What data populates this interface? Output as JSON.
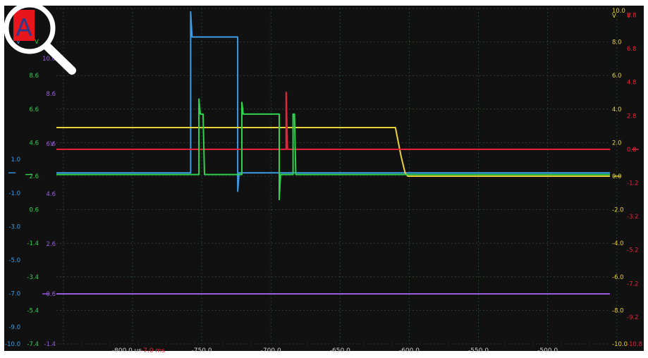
{
  "badge": {
    "letter": "A",
    "bg": "#e8161c",
    "letter_color": "#2d3a8c"
  },
  "colors": {
    "background": "#111111",
    "grid": "#2f4a3a",
    "blue": "#3d9be6",
    "yellow": "#e8d23a",
    "red": "#e8233a",
    "green": "#2fd24c",
    "purple": "#9a5ee0",
    "time_red": "#e8233a",
    "time_white": "#d0d0d0"
  },
  "chart_data": {
    "type": "line",
    "x_axis": {
      "unit_label": "us",
      "range": [
        -855,
        -455
      ],
      "ticks": [
        {
          "v": -800,
          "label": "-800.0"
        },
        {
          "v": -750,
          "label": "-750.0"
        },
        {
          "v": -700,
          "label": "-700.0"
        },
        {
          "v": -650,
          "label": "-650.0"
        },
        {
          "v": -600,
          "label": "-600.0"
        },
        {
          "v": -550,
          "label": "-550.0"
        },
        {
          "v": -500,
          "label": "-500.0"
        }
      ],
      "offset_label": "-7.0 ms"
    },
    "y_axes": [
      {
        "id": "blue-axis",
        "color": "#3d9be6",
        "side": "left",
        "range": [
          -10,
          10
        ],
        "ticks": [
          {
            "v": 1,
            "label": "1.0"
          },
          {
            "v": -1,
            "label": "-1.0"
          },
          {
            "v": -3,
            "label": "-3.0"
          },
          {
            "v": -5,
            "label": "-5.0"
          },
          {
            "v": -7,
            "label": "-7.0"
          },
          {
            "v": -9,
            "label": "-9.0"
          },
          {
            "v": -10,
            "label": "-10.0"
          }
        ]
      },
      {
        "id": "green-axis",
        "color": "#2fd24c",
        "side": "left",
        "range": [
          -7.4,
          12.6
        ],
        "ticks": [
          {
            "v": 8.6,
            "label": "8.6"
          },
          {
            "v": 6.6,
            "label": "6.6"
          },
          {
            "v": 4.6,
            "label": "4.6"
          },
          {
            "v": 2.6,
            "label": "2.6"
          },
          {
            "v": 0.6,
            "label": "0.6"
          },
          {
            "v": -1.4,
            "label": "-1.4"
          },
          {
            "v": -3.4,
            "label": "-3.4"
          },
          {
            "v": -5.4,
            "label": "-5.4"
          },
          {
            "v": -7.4,
            "label": "-7.4"
          }
        ]
      },
      {
        "id": "purple-axis",
        "color": "#9a5ee0",
        "side": "left",
        "range": [
          -1.4,
          12
        ],
        "ticks": [
          {
            "v": 10,
            "label": "10.0"
          },
          {
            "v": 8.6,
            "label": "8.6"
          },
          {
            "v": 6.6,
            "label": "6.6"
          },
          {
            "v": 4.6,
            "label": "4.6"
          },
          {
            "v": 2.6,
            "label": "2.6"
          },
          {
            "v": 0.6,
            "label": "0.6"
          },
          {
            "v": -1.4,
            "label": "-1.4"
          }
        ]
      },
      {
        "id": "yellow-axis",
        "color": "#e8d23a",
        "side": "right",
        "range": [
          -10,
          10
        ],
        "ticks": [
          {
            "v": 10,
            "label": "10.0"
          },
          {
            "v": 8,
            "label": "8.0"
          },
          {
            "v": 6,
            "label": "6.0"
          },
          {
            "v": 4,
            "label": "4.0"
          },
          {
            "v": 2,
            "label": "2.0"
          },
          {
            "v": 0,
            "label": "0.0"
          },
          {
            "v": -2,
            "label": "-2.0"
          },
          {
            "v": -4,
            "label": "-4.0"
          },
          {
            "v": -6,
            "label": "-6.0"
          },
          {
            "v": -8,
            "label": "-8.0"
          },
          {
            "v": -10,
            "label": "-10.0"
          }
        ]
      },
      {
        "id": "red-axis",
        "color": "#e8233a",
        "side": "right",
        "range": [
          -10.8,
          9.2
        ],
        "ticks": [
          {
            "v": 8.8,
            "label": "8.8"
          },
          {
            "v": 6.8,
            "label": "6.8"
          },
          {
            "v": 4.8,
            "label": "4.8"
          },
          {
            "v": 2.8,
            "label": "2.8"
          },
          {
            "v": 0.8,
            "label": "0.8"
          },
          {
            "v": -1.2,
            "label": "-1.2"
          },
          {
            "v": -3.2,
            "label": "-3.2"
          },
          {
            "v": -5.2,
            "label": "-5.2"
          },
          {
            "v": -7.2,
            "label": "-7.2"
          },
          {
            "v": -9.2,
            "label": "-9.2"
          },
          {
            "v": -10.8,
            "label": "-10.8"
          }
        ]
      }
    ],
    "unit_labels": [
      {
        "axis": "blue-axis",
        "text": "V"
      },
      {
        "axis": "green-axis",
        "text": "V"
      },
      {
        "axis": "purple-axis",
        "text": "V"
      },
      {
        "axis": "yellow-axis",
        "text": "V"
      },
      {
        "axis": "red-axis",
        "text": "V"
      }
    ],
    "series": [
      {
        "color": "#3d9be6",
        "axis": "blue-axis",
        "points": [
          [
            -855,
            0.2
          ],
          [
            -758,
            0.2
          ],
          [
            -758,
            9.8
          ],
          [
            -757,
            8.3
          ],
          [
            -724,
            8.3
          ],
          [
            -724,
            -0.9
          ],
          [
            -723,
            0.2
          ],
          [
            -455,
            0.2
          ]
        ]
      },
      {
        "color": "#e8d23a",
        "axis": "yellow-axis",
        "points": [
          [
            -855,
            2.9
          ],
          [
            -610,
            2.9
          ],
          [
            -606,
            1.2
          ],
          [
            -603,
            0.2
          ],
          [
            -601,
            0.0
          ],
          [
            -455,
            0.0
          ]
        ]
      },
      {
        "color": "#e8233a",
        "axis": "red-axis",
        "points": [
          [
            -855,
            0.8
          ],
          [
            -689,
            0.8
          ],
          [
            -689,
            4.2
          ],
          [
            -688,
            0.8
          ],
          [
            -455,
            0.8
          ]
        ]
      },
      {
        "color": "#2fd24c",
        "axis": "green-axis",
        "points": [
          [
            -855,
            2.7
          ],
          [
            -752,
            2.7
          ],
          [
            -752,
            7.2
          ],
          [
            -751,
            6.3
          ],
          [
            -749,
            6.3
          ],
          [
            -748,
            2.7
          ],
          [
            -721,
            2.7
          ],
          [
            -721,
            7.0
          ],
          [
            -720,
            6.3
          ],
          [
            -694,
            6.3
          ],
          [
            -694,
            1.2
          ],
          [
            -693,
            2.7
          ],
          [
            -684,
            2.7
          ],
          [
            -684,
            6.3
          ],
          [
            -683,
            6.3
          ],
          [
            -682,
            2.7
          ],
          [
            -455,
            2.7
          ]
        ]
      },
      {
        "color": "#9a5ee0",
        "axis": "purple-axis",
        "points": [
          [
            -855,
            0.6
          ],
          [
            -455,
            0.6
          ]
        ]
      }
    ]
  }
}
